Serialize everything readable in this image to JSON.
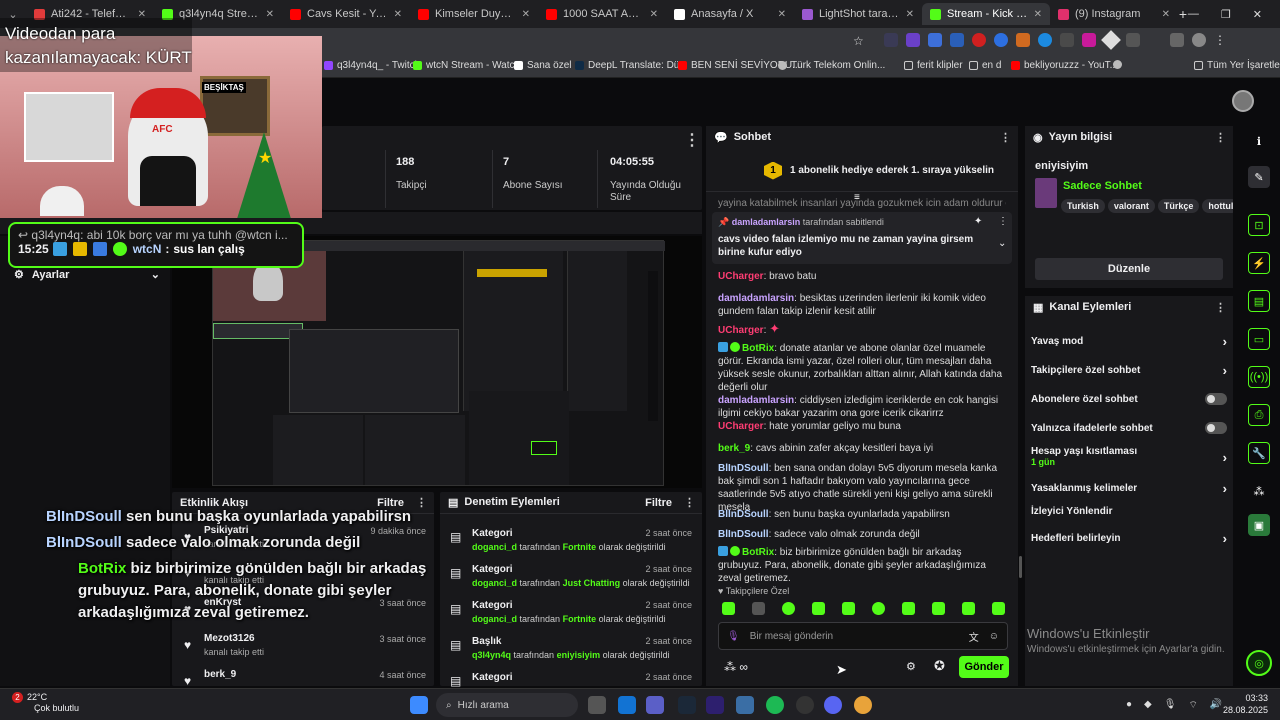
{
  "browser": {
    "tabs": [
      {
        "label": "Ati242 - Telefon (Off...",
        "color": "#e23b3b"
      },
      {
        "label": "q3l4yn4q Stream - W...",
        "color": "#53fc18"
      },
      {
        "label": "Cavs Kesit - YouTube",
        "color": "#ff0000"
      },
      {
        "label": "Kimseler Duymasın İç...",
        "color": "#ff0000"
      },
      {
        "label": "1000 SAAT ASCENDA...",
        "color": "#ff0000"
      },
      {
        "label": "Anasayfa / X",
        "color": "#ffffff"
      },
      {
        "label": "LightShot tarafından...",
        "color": "#9b59d0"
      },
      {
        "label": "Stream - Kick Dashbo...",
        "color": "#53fc18",
        "active": true
      },
      {
        "label": "(9) Instagram",
        "color": "#e1306c"
      }
    ],
    "bookmarks": [
      "q3l4yn4q_ - Twitch",
      "wtcN Stream - Watc...",
      "Sana özel",
      "DeepL Translate: Dü...",
      "BEN SENİ SEVİYORU...",
      "Türk Telekom Onlin...",
      "ferit klipler",
      "en d",
      "bekliyoruzzz - YouT...",
      "Tüm Yer İşaretleri"
    ]
  },
  "overlay": {
    "caption_top": "Videodan para",
    "caption_bottom": "kazanılamayacak: KÜRT",
    "art_santa": "AFC",
    "art_sign": "BEŞİKTAŞ",
    "chat_preview_line": "q3l4yn4q: abi 10k borç var mı ya tuhh @wtcn i...",
    "chat_preview_time": "15:25",
    "chat_preview_user": "wtcN",
    "chat_preview_msg": "sus lan çalış"
  },
  "overlay_chat": [
    {
      "user": "BlInDSoull",
      "text": "sen bunu başka oyunlarlada yapabilirsn",
      "color": "#b8d4ff"
    },
    {
      "user": "BlInDSoull",
      "text": "sadece valo olmak zorunda değil",
      "color": "#b8d4ff"
    },
    {
      "user": "BotRix",
      "text": "biz birbirimize gönülden bağlı bir arkadaş grubuyuz. Para, abonelik, donate gibi şeyler arkadaşlığımıza zeval getiremez.",
      "color": "#53fc18"
    }
  ],
  "dashboard": {
    "stats": [
      {
        "value": "188",
        "label": "Takipçi"
      },
      {
        "value": "7",
        "label": "Abone Sayısı"
      },
      {
        "value": "04:05:55",
        "label": "Yayında Olduğu Süre"
      }
    ],
    "settings_label": "Ayarlar",
    "activity": {
      "title": "Etkinlik Akışı",
      "filter": "Filtre",
      "items": [
        {
          "user": "Psikiyatri",
          "action": "kanalı takip etti",
          "time": "9 dakika önce"
        },
        {
          "user": "",
          "action": "kanalı takip etti",
          "time": ""
        },
        {
          "user": "enKryst",
          "action": "",
          "time": "3 saat önce"
        },
        {
          "user": "Mezot3126",
          "action": "kanalı takip etti",
          "time": "3 saat önce"
        },
        {
          "user": "berk_9",
          "action": "",
          "time": "4 saat önce"
        }
      ]
    },
    "moderation": {
      "title": "Denetim Eylemleri",
      "filter": "Filtre",
      "items": [
        {
          "title": "Kategori",
          "by": "doganci_d",
          "mid": "tarafından",
          "value": "Fortnite",
          "end": "olarak değiştirildi",
          "time": "2 saat önce"
        },
        {
          "title": "Kategori",
          "by": "doganci_d",
          "mid": "tarafından",
          "value": "Just Chatting",
          "end": "olarak değiştirildi",
          "time": "2 saat önce"
        },
        {
          "title": "Kategori",
          "by": "doganci_d",
          "mid": "tarafından",
          "value": "Fortnite",
          "end": "olarak değiştirildi",
          "time": "2 saat önce"
        },
        {
          "title": "Başlık",
          "by": "q3l4yn4q",
          "mid": "tarafından",
          "value": "eniyisiyim",
          "end": "olarak değiştirildi",
          "time": "2 saat önce"
        },
        {
          "title": "Kategori",
          "by": "",
          "mid": "",
          "value": "",
          "end": "",
          "time": "2 saat önce"
        }
      ]
    }
  },
  "chat": {
    "title": "Sohbet",
    "banner": "1 abonelik hediye ederek 1. sıraya yükselin",
    "banner_num": "1",
    "scroll_cut": "yayina katabilmek insanlari yayinda gozukmek icin adam oldurur ole",
    "pinned_by": "damladamlarsin",
    "pinned_suffix": "tarafından sabitlendi",
    "pinned_text": "cavs video falan izlemiyo mu ne zaman yayina girsem birine kufur ediyo",
    "messages": [
      {
        "user": "UCharger",
        "cls": "u-red",
        "text": "bravo batu"
      },
      {
        "user": "damladamlarsin",
        "cls": "u-purple",
        "text": "besiktas uzerinden ilerlenir iki komik video gundem falan takip izlenir kesit atilir"
      },
      {
        "user": "UCharger",
        "cls": "u-red",
        "text": ""
      },
      {
        "user": "BotRix",
        "cls": "u-green",
        "text": "donate atanlar ve abone olanlar özel muamele görür. Ekranda ismi yazar, özel rolleri olur, tüm mesajları daha yüksek sesle okunur, zorbalıkları alttan alınır, Allah katında daha değerli olur"
      },
      {
        "user": "damladamlarsin",
        "cls": "u-purple",
        "text": "ciddiysen izledigim iceriklerde en cok hangisi ilgimi cekiyo bakar yazarim ona gore icerik cikarirrz"
      },
      {
        "user": "UCharger",
        "cls": "u-red",
        "text": "hate yorumlar geliyo mu buna"
      },
      {
        "user": "berk_9",
        "cls": "u-green",
        "text": "cavs abinin zafer akçay kesitleri baya iyi"
      },
      {
        "user": "BlInDSoull",
        "cls": "u-blue",
        "text": "ben sana ondan dolayı 5v5 diyorum mesela kanka bak şimdi son 1 haftadır bakıyom valo yayıncılarına gece saatlerinde 5v5 atıyo chatle sürekli yeni kişi geliyo ama sürekli mesela"
      },
      {
        "user": "BlInDSoull",
        "cls": "u-blue",
        "text": "sen bunu başka oyunlarlada yapabilirsn"
      },
      {
        "user": "BlInDSoull",
        "cls": "u-blue",
        "text": "sadece valo olmak zorunda değil"
      },
      {
        "user": "BotRix",
        "cls": "u-green",
        "text": "biz birbirimize gönülden bağlı bir arkadaş grubuyuz. Para, abonelik, donate gibi şeyler arkadaşlığımıza zeval getiremez."
      }
    ],
    "followers_only": "Takipçilere Özel",
    "input_placeholder": "Bir mesaj gönderin",
    "send_label": "Gönder"
  },
  "stream_info": {
    "title": "Yayın bilgisi",
    "stream_title": "eniyisiyim",
    "category": "Sadece Sohbet",
    "tags": [
      "Turkish",
      "valorant",
      "Türkçe",
      "hottul"
    ],
    "edit_label": "Düzenle"
  },
  "channel_actions": {
    "title": "Kanal Eylemleri",
    "items": [
      {
        "label": "Yavaş mod",
        "kind": "chevron",
        "sub": ""
      },
      {
        "label": "Takipçilere özel sohbet",
        "kind": "chevron",
        "sub": ""
      },
      {
        "label": "Abonelere özel sohbet",
        "kind": "toggle",
        "sub": ""
      },
      {
        "label": "Yalnızca ifadelerle sohbet",
        "kind": "toggle",
        "sub": ""
      },
      {
        "label": "Hesap yaşı kısıtlaması",
        "kind": "chevron",
        "sub": "1 gün"
      },
      {
        "label": "Yasaklanmış kelimeler",
        "kind": "chevron",
        "sub": ""
      },
      {
        "label": "İzleyici Yönlendir",
        "kind": "none",
        "sub": ""
      },
      {
        "label": "Hedefleri belirleyin",
        "kind": "chevron",
        "sub": ""
      }
    ]
  },
  "windows": {
    "activate_title": "Windows'u Etkinleştir",
    "activate_sub": "Windows'u etkinleştirmek için Ayarlar'a gidin.",
    "weather_temp": "22°C",
    "weather_desc": "Çok bulutlu",
    "search_placeholder": "Hızlı arama",
    "clock_time": "03:33",
    "clock_date": "28.08.2025",
    "notif_count": "2"
  },
  "colors": {
    "kick_green": "#53fc18",
    "panel": "#18181b",
    "bg": "#0b0b0d"
  }
}
